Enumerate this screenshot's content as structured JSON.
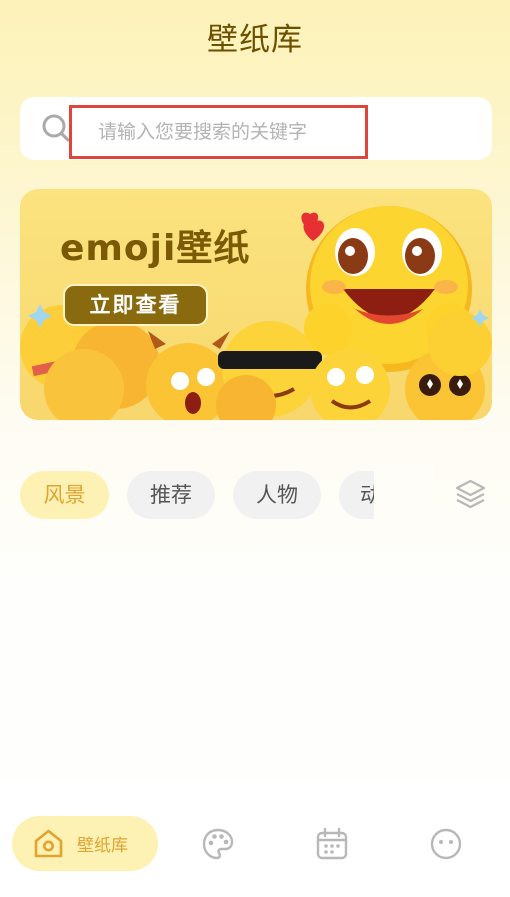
{
  "header": {
    "title": "壁纸库"
  },
  "search": {
    "placeholder": "请输入您要搜索的关键字",
    "value": ""
  },
  "banner": {
    "title": "emoji壁纸",
    "button_label": "立即查看"
  },
  "categories": [
    {
      "label": "风景",
      "active": true
    },
    {
      "label": "推荐",
      "active": false
    },
    {
      "label": "人物",
      "active": false
    },
    {
      "label": "动",
      "active": false
    }
  ],
  "icons": {
    "search": "search-icon",
    "layers": "layers-icon",
    "home": "home-icon",
    "palette": "palette-icon",
    "calendar": "calendar-icon",
    "face": "face-icon"
  },
  "tabbar": {
    "home_label": "壁纸库"
  },
  "colors": {
    "accent": "#e0a42f",
    "brand_dark": "#6d4f00",
    "highlight_border": "#e0453c"
  }
}
